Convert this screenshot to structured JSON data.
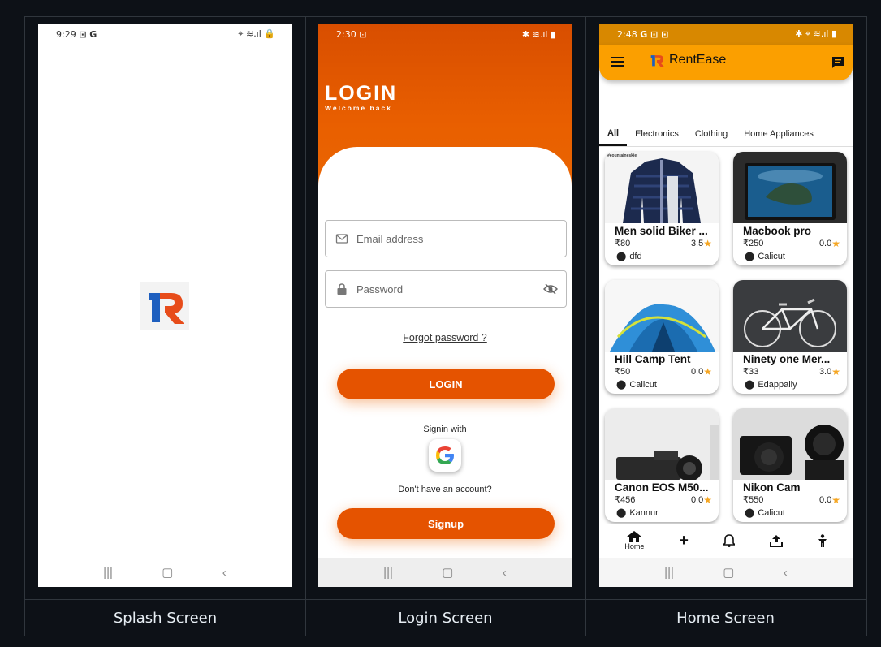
{
  "captions": {
    "splash": "Splash Screen",
    "login": "Login Screen",
    "home": "Home Screen"
  },
  "splash": {
    "time": "9:29",
    "status_icons": "⊡ G",
    "right_icons": "⌖ ≋.ıl 🔒"
  },
  "login": {
    "time": "2:30",
    "status_icons": "⊡",
    "right_icons": "✱ ≋.ıl ▮",
    "title": "LOGIN",
    "subtitle": "Welcome back",
    "email_placeholder": "Email address",
    "password_placeholder": "Password",
    "forgot": "Forgot password ?",
    "login_button": "LOGIN",
    "signin_with": "Signin with",
    "no_account": "Don't have an account?",
    "signup_button": "Signup",
    "accent": "#e55300"
  },
  "home": {
    "time": "2:48",
    "status_icons": "G ⊡ ⊡",
    "right_icons": "✱ ⌖ ≋.ıl ▮",
    "app_name": "RentEase",
    "accent": "#fb9f00",
    "tabs": [
      "All",
      "Electronics",
      "Clothing",
      "Home Appliances"
    ],
    "products": [
      {
        "title": "Men solid Biker ...",
        "price": "₹80",
        "rating": "3.5",
        "location": "dfd",
        "img_label": "#eountaineskie"
      },
      {
        "title": "Macbook pro",
        "price": "₹250",
        "rating": "0.0",
        "location": "Calicut"
      },
      {
        "title": "Hill Camp Tent",
        "price": "₹50",
        "rating": "0.0",
        "location": "Calicut"
      },
      {
        "title": "Ninety one Mer...",
        "price": "₹33",
        "rating": "3.0",
        "location": "Edappally"
      },
      {
        "title": "Canon EOS M50...",
        "price": "₹456",
        "rating": "0.0",
        "location": "Kannur"
      },
      {
        "title": "Nikon Cam",
        "price": "₹550",
        "rating": "0.0",
        "location": "Calicut"
      }
    ],
    "bottom_nav": {
      "home_label": "Home"
    }
  }
}
